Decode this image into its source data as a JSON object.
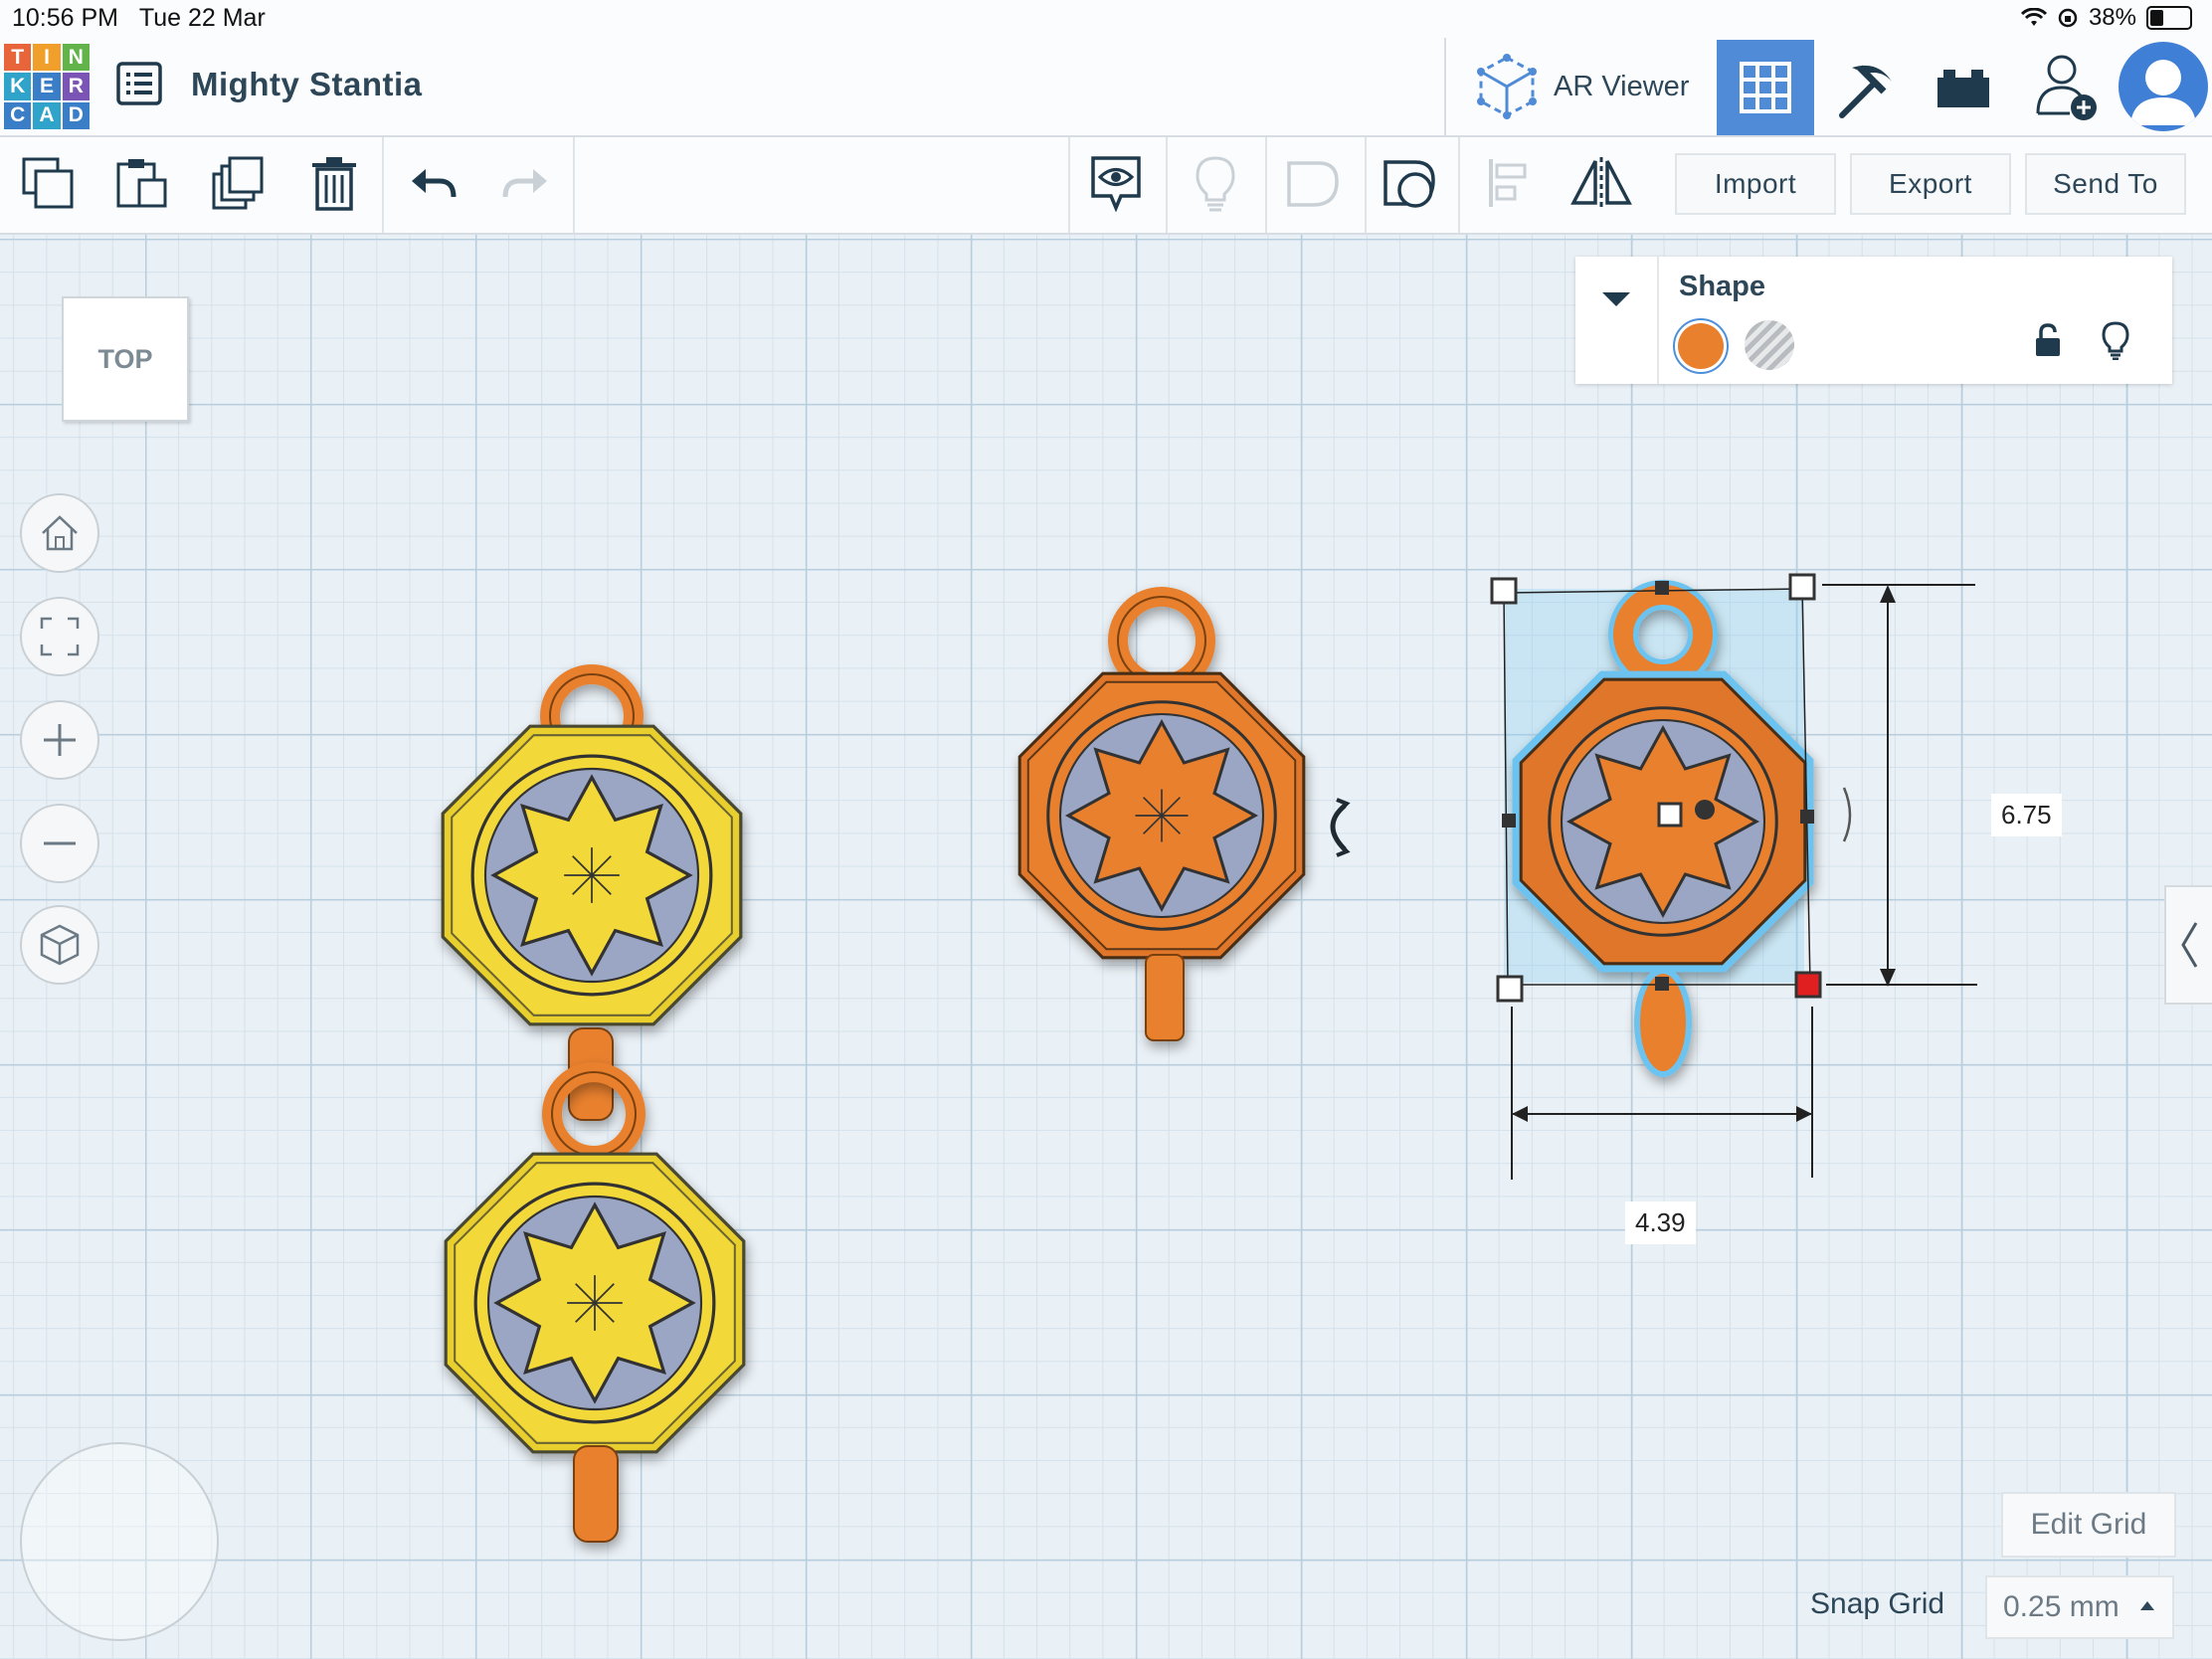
{
  "status_bar": {
    "time": "10:56 PM",
    "date": "Tue 22 Mar",
    "battery": "38%"
  },
  "header": {
    "logo_letters": [
      "T",
      "I",
      "N",
      "K",
      "E",
      "R",
      "C",
      "A",
      "D"
    ],
    "logo_colors": [
      "#e8643a",
      "#f0a02a",
      "#62b34a",
      "#2fa3c9",
      "#3a7ec7",
      "#7b55b6",
      "#e8643a",
      "#f0a02a",
      "#62b34a"
    ],
    "project_title": "Mighty Stantia",
    "ar_viewer_label": "AR Viewer",
    "icons": [
      "list-icon",
      "ar-cube-icon",
      "grid-view-icon",
      "pickaxe-icon",
      "brick-icon",
      "add-user-icon",
      "avatar"
    ]
  },
  "toolbar": {
    "import_label": "Import",
    "export_label": "Export",
    "send_to_label": "Send To",
    "icons": [
      "copy-icon",
      "paste-icon",
      "duplicate-icon",
      "delete-icon",
      "undo-icon",
      "redo-icon",
      "notes-icon",
      "light-icon",
      "shape-icon",
      "group-icon",
      "align-icon",
      "mirror-icon"
    ]
  },
  "viewcube": {
    "label": "TOP"
  },
  "shape_panel": {
    "title": "Shape",
    "solid_color": "#e8802e",
    "selected": "solid"
  },
  "workplane": {
    "width_dimension": "4.39",
    "height_dimension": "6.75",
    "edit_grid_label": "Edit Grid",
    "snap_grid_label": "Snap Grid",
    "snap_grid_value": "0.25 mm"
  },
  "colors": {
    "accent": "#4f8bd6",
    "orange": "#e8802e",
    "yellow": "#f2d838",
    "selection": "#6cc3ef"
  }
}
